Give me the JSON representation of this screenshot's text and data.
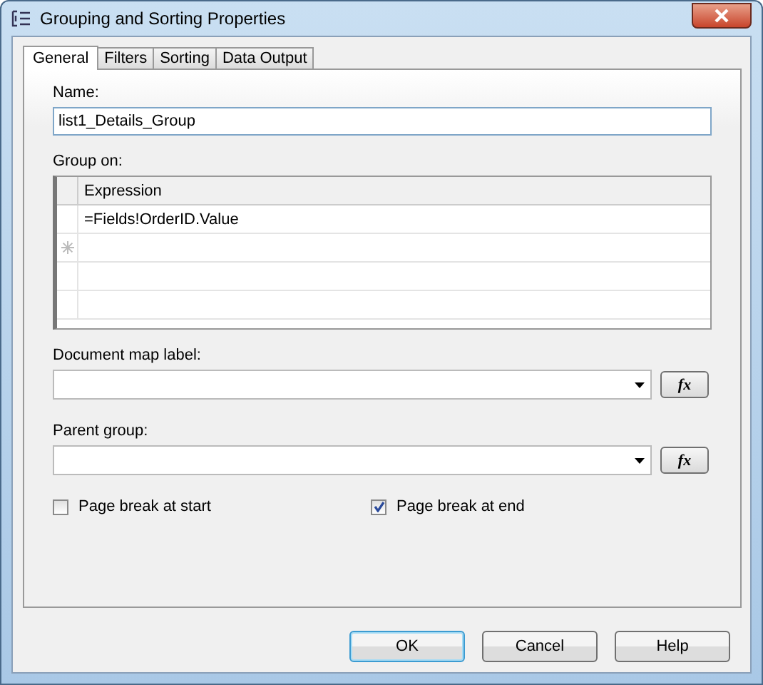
{
  "window": {
    "title": "Grouping and Sorting Properties"
  },
  "tabs": [
    {
      "label": "General",
      "selected": true
    },
    {
      "label": "Filters",
      "selected": false
    },
    {
      "label": "Sorting",
      "selected": false
    },
    {
      "label": "Data Output",
      "selected": false
    }
  ],
  "name": {
    "label": "Name:",
    "value": "list1_Details_Group"
  },
  "group_on": {
    "label": "Group on:",
    "columns": [
      "Expression"
    ],
    "rows": [
      {
        "expression": "=Fields!OrderID.Value",
        "new_row": false
      },
      {
        "expression": "",
        "new_row": true
      },
      {
        "expression": "",
        "new_row": false
      },
      {
        "expression": "",
        "new_row": false
      }
    ]
  },
  "document_map_label": {
    "label": "Document map label:",
    "button": "fx"
  },
  "parent_group": {
    "label": "Parent group:",
    "button": "fx"
  },
  "checkboxes": [
    {
      "label": "Page break at start",
      "checked": false
    },
    {
      "label": "Page break at end",
      "checked": true
    }
  ],
  "buttons": [
    {
      "label": "OK",
      "default": true
    },
    {
      "label": "Cancel",
      "default": false
    },
    {
      "label": "Help",
      "default": false
    }
  ]
}
